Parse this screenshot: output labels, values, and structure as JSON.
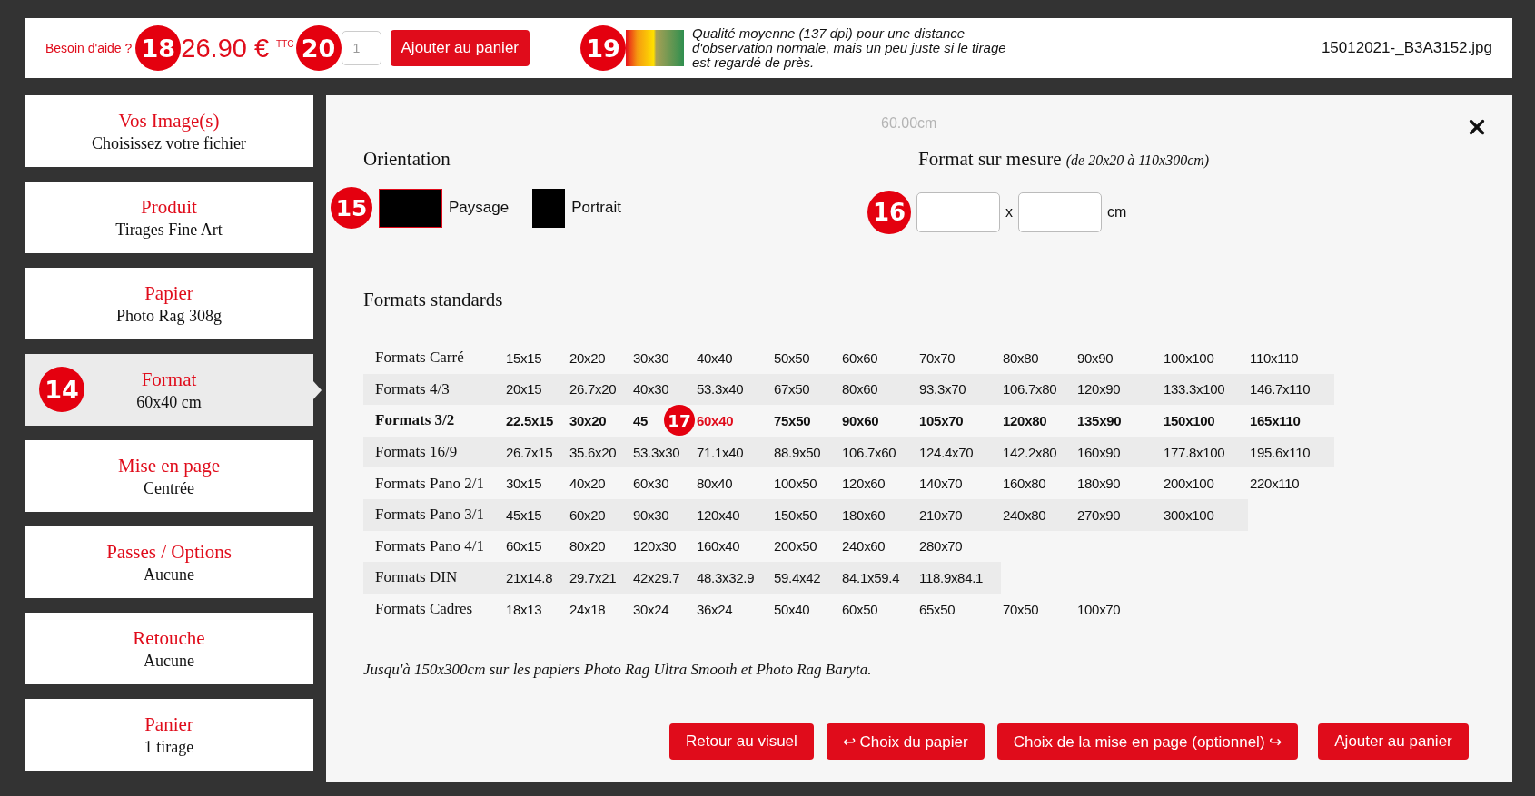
{
  "top_bar": {
    "help_link": "Besoin d'aide ?",
    "price": "26.90 €",
    "price_suffix": "TTC",
    "quantity": "1",
    "add_button": "Ajouter au panier",
    "quality_text": "Qualité moyenne (137 dpi) pour une distance d'observation normale, mais un peu juste si le tirage est regardé de près.",
    "filename": "15012021-_B3A3152.jpg"
  },
  "sidebar": {
    "items": [
      {
        "title": "Vos Image(s)",
        "subtitle": "Choisissez votre fichier",
        "selected": false
      },
      {
        "title": "Produit",
        "subtitle": "Tirages Fine Art",
        "selected": false
      },
      {
        "title": "Papier",
        "subtitle": "Photo Rag 308g",
        "selected": false
      },
      {
        "title": "Format",
        "subtitle": "60x40 cm",
        "selected": true
      },
      {
        "title": "Mise en page",
        "subtitle": "Centrée",
        "selected": false
      },
      {
        "title": "Passes / Options",
        "subtitle": "Aucune",
        "selected": false
      },
      {
        "title": "Retouche",
        "subtitle": "Aucune",
        "selected": false
      },
      {
        "title": "Panier",
        "subtitle": "1 tirage",
        "selected": false
      }
    ]
  },
  "modal": {
    "dimension_label": "60.00cm",
    "orientation": {
      "heading": "Orientation",
      "options": [
        {
          "label": "Paysage",
          "kind": "landscape",
          "selected": true
        },
        {
          "label": "Portrait",
          "kind": "portrait",
          "selected": false
        }
      ]
    },
    "custom_format": {
      "heading": "Format sur mesure",
      "range": "(de 20x20 à 110x300cm)",
      "separator": "x",
      "unit": "cm"
    },
    "standard": {
      "heading": "Formats standards",
      "rows": [
        {
          "label": "Formats Carré",
          "selected": false,
          "cells": [
            {
              "text": "15x15",
              "selected": false
            },
            {
              "text": "20x20",
              "selected": false
            },
            {
              "text": "30x30",
              "selected": false
            },
            {
              "text": "40x40",
              "selected": false
            },
            {
              "text": "50x50",
              "selected": false
            },
            {
              "text": "60x60",
              "selected": false
            },
            {
              "text": "70x70",
              "selected": false
            },
            {
              "text": "80x80",
              "selected": false
            },
            {
              "text": "90x90",
              "selected": false
            },
            {
              "text": "100x100",
              "selected": false
            },
            {
              "text": "110x110",
              "selected": false
            }
          ]
        },
        {
          "label": "Formats 4/3",
          "selected": false,
          "cells": [
            {
              "text": "20x15",
              "selected": false
            },
            {
              "text": "26.7x20",
              "selected": false
            },
            {
              "text": "40x30",
              "selected": false
            },
            {
              "text": "53.3x40",
              "selected": false
            },
            {
              "text": "67x50",
              "selected": false
            },
            {
              "text": "80x60",
              "selected": false
            },
            {
              "text": "93.3x70",
              "selected": false
            },
            {
              "text": "106.7x80",
              "selected": false
            },
            {
              "text": "120x90",
              "selected": false
            },
            {
              "text": "133.3x100",
              "selected": false
            },
            {
              "text": "146.7x110",
              "selected": false
            }
          ]
        },
        {
          "label": "Formats 3/2",
          "selected": true,
          "cells": [
            {
              "text": "22.5x15",
              "selected": false
            },
            {
              "text": "30x20",
              "selected": false
            },
            {
              "text": "45",
              "selected": false
            },
            {
              "text": "60x40",
              "selected": true
            },
            {
              "text": "75x50",
              "selected": false
            },
            {
              "text": "90x60",
              "selected": false
            },
            {
              "text": "105x70",
              "selected": false
            },
            {
              "text": "120x80",
              "selected": false
            },
            {
              "text": "135x90",
              "selected": false
            },
            {
              "text": "150x100",
              "selected": false
            },
            {
              "text": "165x110",
              "selected": false
            }
          ]
        },
        {
          "label": "Formats 16/9",
          "selected": false,
          "cells": [
            {
              "text": "26.7x15",
              "selected": false
            },
            {
              "text": "35.6x20",
              "selected": false
            },
            {
              "text": "53.3x30",
              "selected": false
            },
            {
              "text": "71.1x40",
              "selected": false
            },
            {
              "text": "88.9x50",
              "selected": false
            },
            {
              "text": "106.7x60",
              "selected": false
            },
            {
              "text": "124.4x70",
              "selected": false
            },
            {
              "text": "142.2x80",
              "selected": false
            },
            {
              "text": "160x90",
              "selected": false
            },
            {
              "text": "177.8x100",
              "selected": false
            },
            {
              "text": "195.6x110",
              "selected": false
            }
          ]
        },
        {
          "label": "Formats Pano 2/1",
          "selected": false,
          "cells": [
            {
              "text": "30x15",
              "selected": false
            },
            {
              "text": "40x20",
              "selected": false
            },
            {
              "text": "60x30",
              "selected": false
            },
            {
              "text": "80x40",
              "selected": false
            },
            {
              "text": "100x50",
              "selected": false
            },
            {
              "text": "120x60",
              "selected": false
            },
            {
              "text": "140x70",
              "selected": false
            },
            {
              "text": "160x80",
              "selected": false
            },
            {
              "text": "180x90",
              "selected": false
            },
            {
              "text": "200x100",
              "selected": false
            },
            {
              "text": "220x110",
              "selected": false
            }
          ]
        },
        {
          "label": "Formats Pano 3/1",
          "selected": false,
          "cells": [
            {
              "text": "45x15",
              "selected": false
            },
            {
              "text": "60x20",
              "selected": false
            },
            {
              "text": "90x30",
              "selected": false
            },
            {
              "text": "120x40",
              "selected": false
            },
            {
              "text": "150x50",
              "selected": false
            },
            {
              "text": "180x60",
              "selected": false
            },
            {
              "text": "210x70",
              "selected": false
            },
            {
              "text": "240x80",
              "selected": false
            },
            {
              "text": "270x90",
              "selected": false
            },
            {
              "text": "300x100",
              "selected": false
            }
          ]
        },
        {
          "label": "Formats Pano 4/1",
          "selected": false,
          "cells": [
            {
              "text": "60x15",
              "selected": false
            },
            {
              "text": "80x20",
              "selected": false
            },
            {
              "text": "120x30",
              "selected": false
            },
            {
              "text": "160x40",
              "selected": false
            },
            {
              "text": "200x50",
              "selected": false
            },
            {
              "text": "240x60",
              "selected": false
            },
            {
              "text": "280x70",
              "selected": false
            }
          ]
        },
        {
          "label": "Formats DIN",
          "selected": false,
          "cells": [
            {
              "text": "21x14.8",
              "selected": false
            },
            {
              "text": "29.7x21",
              "selected": false
            },
            {
              "text": "42x29.7",
              "selected": false
            },
            {
              "text": "48.3x32.9",
              "selected": false
            },
            {
              "text": "59.4x42",
              "selected": false
            },
            {
              "text": "84.1x59.4",
              "selected": false
            },
            {
              "text": "118.9x84.1",
              "selected": false
            }
          ]
        },
        {
          "label": "Formats Cadres",
          "selected": false,
          "cells": [
            {
              "text": "18x13",
              "selected": false
            },
            {
              "text": "24x18",
              "selected": false
            },
            {
              "text": "30x24",
              "selected": false
            },
            {
              "text": "36x24",
              "selected": false
            },
            {
              "text": "50x40",
              "selected": false
            },
            {
              "text": "60x50",
              "selected": false
            },
            {
              "text": "65x50",
              "selected": false
            },
            {
              "text": "70x50",
              "selected": false
            },
            {
              "text": "100x70",
              "selected": false
            }
          ]
        }
      ]
    },
    "note": "Jusqu'à 150x300cm sur les papiers Photo Rag Ultra Smooth et Photo Rag Baryta.",
    "buttons": [
      {
        "label": "Retour au visuel"
      },
      {
        "label": "↩ Choix du papier"
      },
      {
        "label": "Choix de la mise en page (optionnel) ↪"
      },
      {
        "label": "Ajouter au panier"
      }
    ]
  },
  "markers": [
    {
      "label": "18"
    },
    {
      "label": "20"
    },
    {
      "label": "19"
    },
    {
      "label": "14"
    },
    {
      "label": "15"
    },
    {
      "label": "16"
    },
    {
      "label": "17"
    }
  ]
}
